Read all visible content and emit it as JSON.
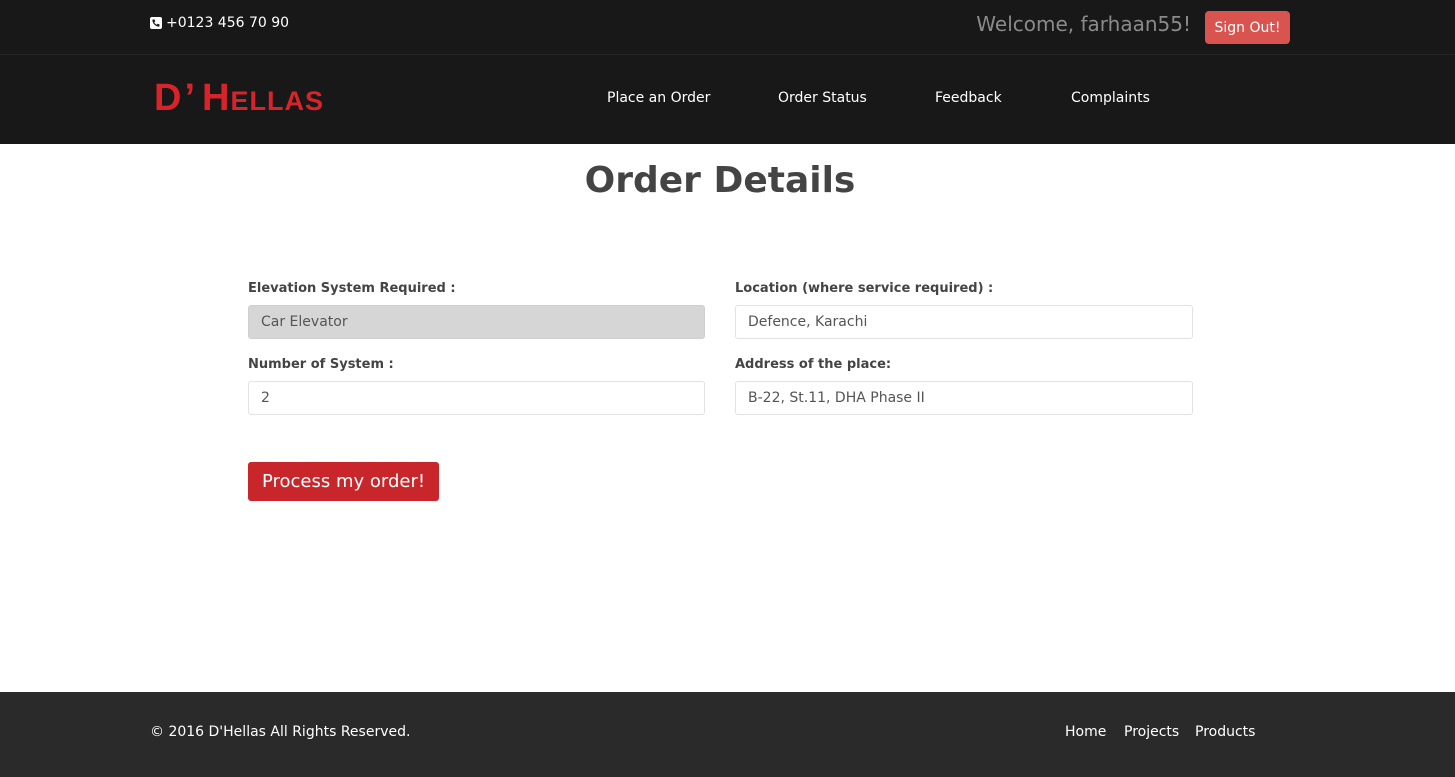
{
  "topbar": {
    "phone_icon": "phone-icon",
    "phone": "+0123 456 70 90",
    "welcome": "Welcome, farhaan55!",
    "signout_label": "Sign Out!"
  },
  "navbar": {
    "logo_first": "D",
    "logo_apostrophe": "’",
    "logo_h": "H",
    "logo_rest": "ELLAS",
    "items": [
      {
        "label": "Place an Order"
      },
      {
        "label": "Order Status"
      },
      {
        "label": "Feedback"
      },
      {
        "label": "Complaints"
      }
    ]
  },
  "main": {
    "title": "Order Details",
    "fields": {
      "elevation": {
        "label": "Elevation System Required :",
        "value": "Car Elevator"
      },
      "location": {
        "label": "Location (where service required) :",
        "value": "Defence, Karachi"
      },
      "count": {
        "label": "Number of System :",
        "value": "2"
      },
      "address": {
        "label": "Address of the place:",
        "value": "B-22, St.11, DHA Phase II"
      }
    },
    "submit_label": "Process my order!"
  },
  "footer": {
    "copyright": "© 2016 D'Hellas All Rights Reserved.",
    "links": [
      {
        "label": "Home"
      },
      {
        "label": "Projects"
      },
      {
        "label": "Products"
      }
    ]
  },
  "colors": {
    "header_bg": "#181818",
    "brand_red": "#d9232a",
    "signout_bg": "#d9534f",
    "submit_bg": "#c9262c",
    "footer_bg": "#2a2a2a"
  }
}
